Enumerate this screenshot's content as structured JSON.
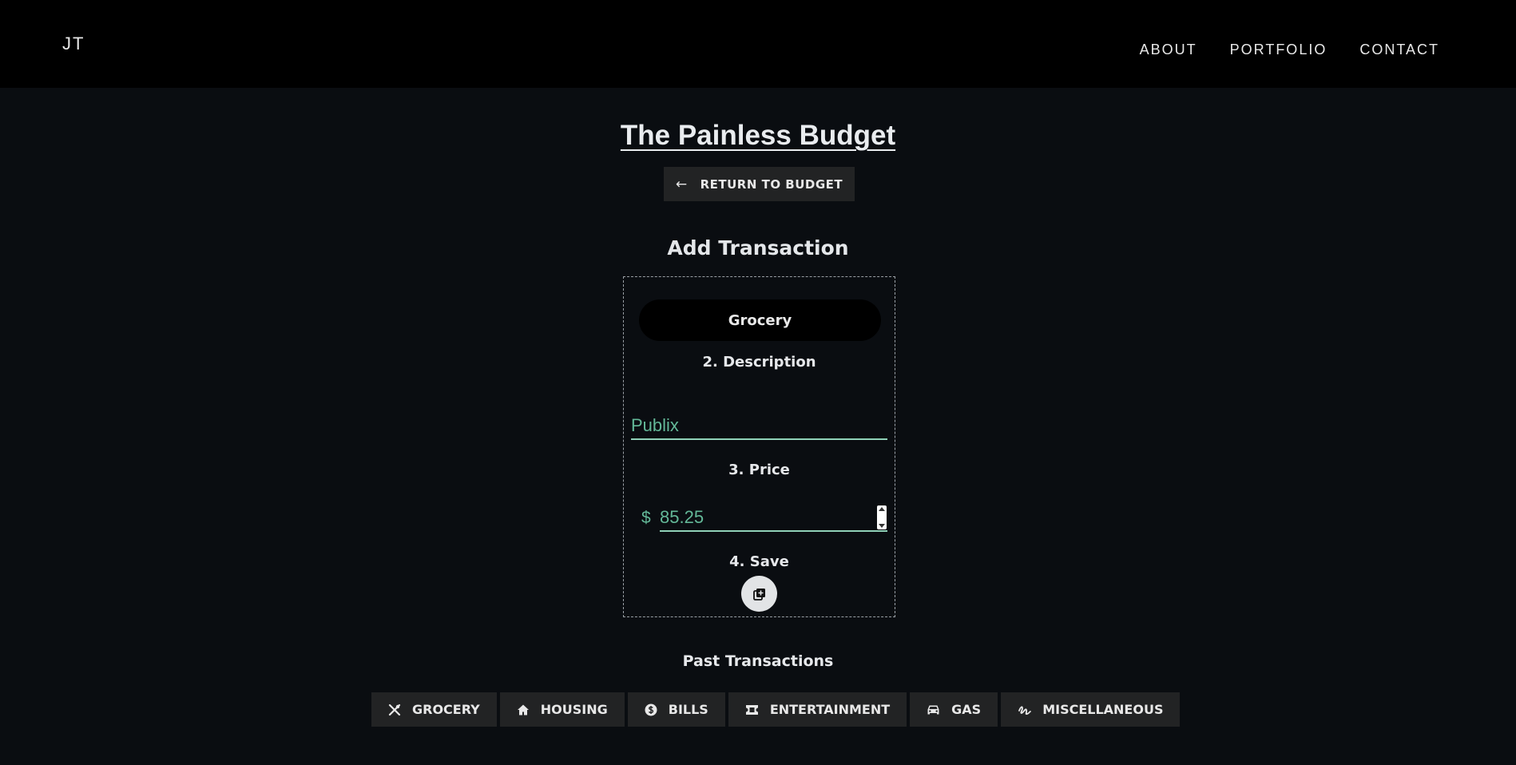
{
  "header": {
    "logo": "JT",
    "nav": [
      "ABOUT",
      "PORTFOLIO",
      "CONTACT"
    ]
  },
  "page": {
    "title": "The Painless Budget",
    "return_label": "RETURN TO BUDGET",
    "form_heading": "Add Transaction"
  },
  "form": {
    "category_value": "Grocery",
    "description_label": "2. Description",
    "description_value": "Publix",
    "price_label": "3. Price",
    "currency_symbol": "$",
    "price_value": "85.25",
    "save_label": "4. Save"
  },
  "past": {
    "heading": "Past Transactions",
    "categories": [
      {
        "label": "GROCERY",
        "icon": "utensils-icon"
      },
      {
        "label": "HOUSING",
        "icon": "home-icon"
      },
      {
        "label": "BILLS",
        "icon": "dollar-coin-icon"
      },
      {
        "label": "ENTERTAINMENT",
        "icon": "ticket-icon"
      },
      {
        "label": "GAS",
        "icon": "car-icon"
      },
      {
        "label": "MISCELLANEOUS",
        "icon": "squiggle-icon"
      }
    ]
  },
  "colors": {
    "accent": "#63b898",
    "underline": "#8fd1b8",
    "button_bg": "#222324",
    "page_bg": "#0a0d11"
  }
}
